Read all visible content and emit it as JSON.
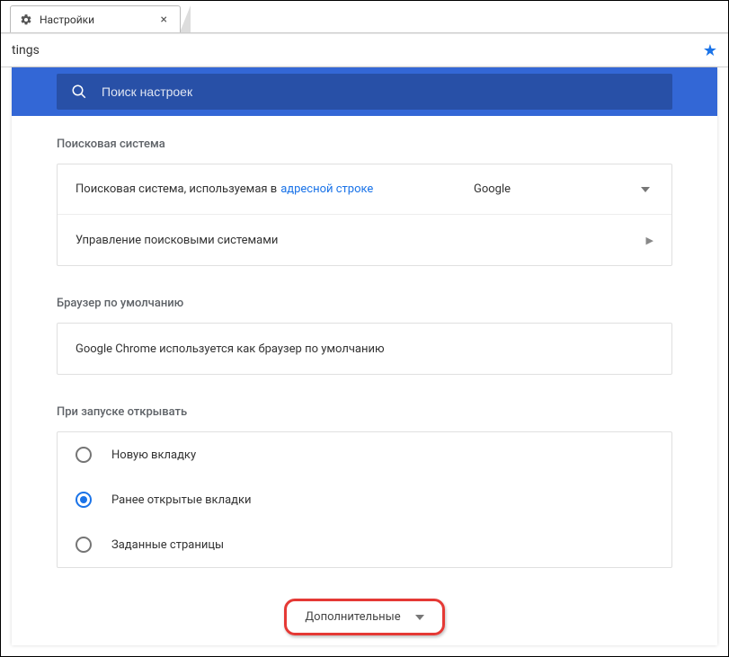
{
  "tab": {
    "title": "Настройки"
  },
  "address": {
    "text": "tings"
  },
  "search": {
    "placeholder": "Поиск настроек"
  },
  "sections": {
    "search_engine": {
      "title": "Поисковая система",
      "row1_prefix": "Поисковая система, используемая в",
      "row1_link": "адресной строке",
      "dropdown_value": "Google",
      "row2_label": "Управление поисковыми системами"
    },
    "default_browser": {
      "title": "Браузер по умолчанию",
      "text": "Google Chrome используется как браузер по умолчанию"
    },
    "on_startup": {
      "title": "При запуске открывать",
      "opt1": "Новую вкладку",
      "opt2": "Ранее открытые вкладки",
      "opt3": "Заданные страницы",
      "selected_index": 1
    }
  },
  "advanced": {
    "label": "Дополнительные"
  }
}
